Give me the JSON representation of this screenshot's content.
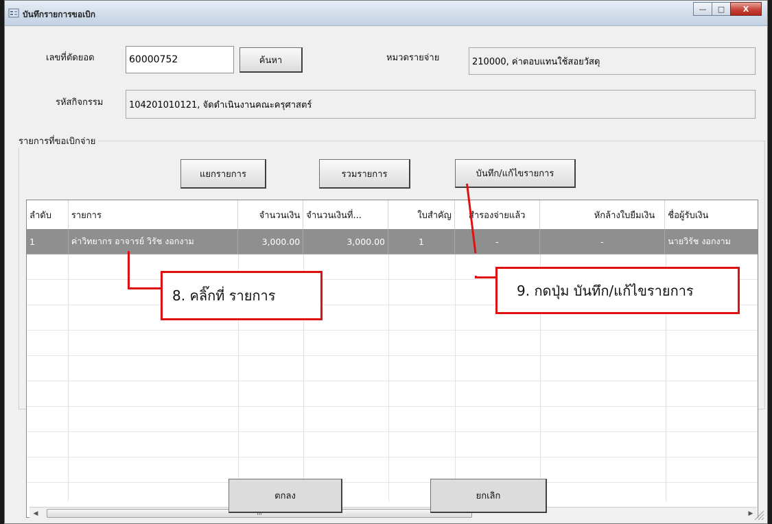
{
  "window": {
    "title": "บันทึกรายการขอเบิก",
    "controls": {
      "minimize": "—",
      "maximize": "□",
      "close": "X"
    }
  },
  "form": {
    "cutoff_label": "เลขที่ตัดยอด",
    "cutoff_value": "60000752",
    "search_label": "ค้นหา",
    "expense_label": "หมวดรายจ่าย",
    "expense_value": "210000, ค่าตอบแทนใช้สอยวัสดุ",
    "activity_label": "รหัสกิจกรรม",
    "activity_value": "104201010121, จัดดำเนินงานคณะครุศาสตร์"
  },
  "group": {
    "title": "รายการที่ขอเบิกจ่าย",
    "split_label": "แยกรายการ",
    "merge_label": "รวมรายการ",
    "save_label": "บันทึก/แก้ไขรายการ"
  },
  "grid": {
    "columns": [
      "ลำดับ",
      "รายการ",
      "จำนวนเงิน",
      "จำนวนเงินที่...",
      "ใบสำคัญ",
      "สำรองจ่ายแล้ว",
      "หักล้างใบยืมเงิน",
      "ชื่อผู้รับเงิน"
    ],
    "rows": [
      [
        "1",
        "ค่าวิทยากร อาจารย์ วิรัช งอกงาม",
        "3,000.00",
        "3,000.00",
        "1",
        "-",
        "-",
        "นายวิรัช งอกงาม"
      ]
    ]
  },
  "scrollbar": {
    "thumb_glyph": "III",
    "left_arrow": "◀",
    "right_arrow": "▶"
  },
  "footer": {
    "ok_label": "ตกลง",
    "cancel_label": "ยกเลิก"
  },
  "annotations": {
    "step8": "8. คลิ๊กที่ รายการ",
    "step9": "9. กดปุ่ม บันทึก/แก้ไขรายการ"
  },
  "colors": {
    "selected_row": "#8f8f8f",
    "callout": "#e01010"
  }
}
